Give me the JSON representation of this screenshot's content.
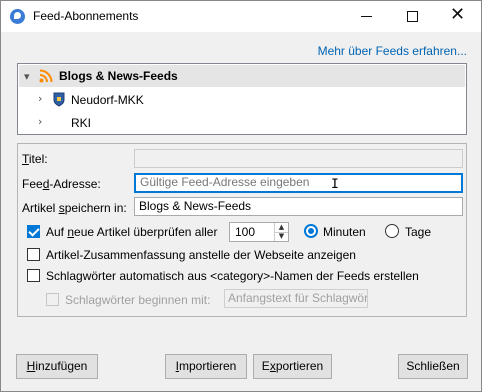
{
  "window": {
    "title": "Feed-Abonnements",
    "close_glyph": "✕"
  },
  "more_link": "Mehr über Feeds erfahren...",
  "tree": {
    "items": [
      {
        "label": "Blogs & News-Feeds",
        "icon": "rss-icon",
        "selected": true
      },
      {
        "label": "Neudorf-MKK",
        "icon": "shield-icon"
      },
      {
        "label": "RKI",
        "icon": ""
      }
    ]
  },
  "form": {
    "title_label": "Titel:",
    "title_value": "",
    "feed_address_label": "Feed-Adresse:",
    "feed_address_placeholder": "Gültige Feed-Adresse eingeben",
    "store_articles_label": "Artikel speichern in:",
    "store_articles_value": "Blogs & News-Feeds",
    "check_updates": {
      "label": "Auf neue Artikel überprüfen aller",
      "checked": true,
      "interval": "100",
      "unit_minutes": "Minuten",
      "unit_days": "Tage",
      "selected_unit": "Minuten"
    },
    "summary_label": "Artikel-Zusammenfassung anstelle der Webseite anzeigen",
    "summary_checked": false,
    "tags_label": "Schlagwörter automatisch aus <category>-Namen der Feeds erstellen",
    "tags_checked": false,
    "prefix_label": "Schlagwörter beginnen mit:",
    "prefix_placeholder": "Anfangstext für Schlagwör",
    "prefix_checked": false
  },
  "buttons": {
    "add": "Hinzufügen",
    "import": "Importieren",
    "export": "Exportieren",
    "close": "Schließen"
  },
  "colors": {
    "accent": "#0078d7",
    "link": "#0063b1",
    "rss": "#ff8c00"
  }
}
